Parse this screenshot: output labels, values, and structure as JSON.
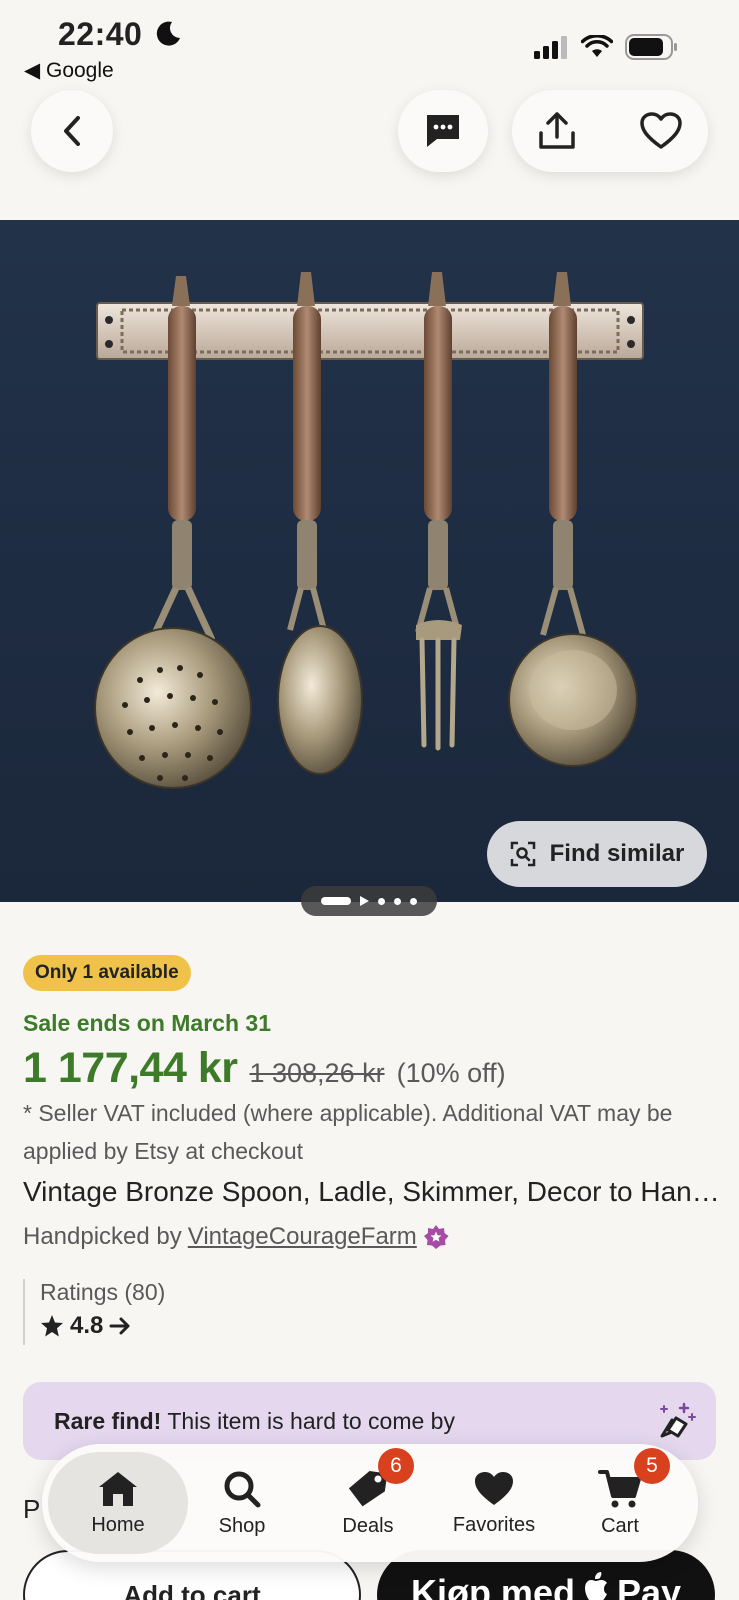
{
  "status_bar": {
    "time": "22:40",
    "back_app": "◀ Google"
  },
  "nav": {
    "back_icon": "chevron-left-icon",
    "message_icon": "message-icon",
    "share_icon": "share-icon",
    "favorite_icon": "heart-icon"
  },
  "hero": {
    "find_similar_label": "Find similar",
    "image_count": 5,
    "current_image": 1
  },
  "listing": {
    "badge": "Only 1 available",
    "sale_text": "Sale ends on March 31",
    "price": "1 177,44 kr",
    "old_price": "1 308,26 kr",
    "discount": "(10% off)",
    "vat_note": "* Seller VAT included (where applicable). Additional VAT may be applied by Etsy at checkout",
    "title": "Vintage Bronze Spoon, Ladle, Skimmer, Decor to Hang on the Wall",
    "handpicked_prefix": "Handpicked by",
    "shop_name": "VintageCourageFarm",
    "ratings_label": "Ratings (80)",
    "rating_value": "4.8"
  },
  "rare_find": {
    "bold": "Rare find!",
    "text": "This item is hard to come by"
  },
  "partial_heading": "P",
  "buttons": {
    "add_to_cart": "Add to cart",
    "pay_prefix": "Kjøp med",
    "pay_brand": "Pay"
  },
  "tabbar": {
    "tabs": [
      {
        "label": "Home",
        "icon": "home-icon",
        "active": true
      },
      {
        "label": "Shop",
        "icon": "search-icon"
      },
      {
        "label": "Deals",
        "icon": "tag-icon",
        "badge": "6"
      },
      {
        "label": "Favorites",
        "icon": "heart-icon"
      },
      {
        "label": "Cart",
        "icon": "cart-icon",
        "badge": "5"
      }
    ]
  },
  "colors": {
    "sale_green": "#3d7a2a",
    "badge_yellow": "#f1c24a",
    "rare_bg": "#e4d7ee",
    "notification_red": "#d8401e",
    "star_badge": "#a64ca6"
  }
}
